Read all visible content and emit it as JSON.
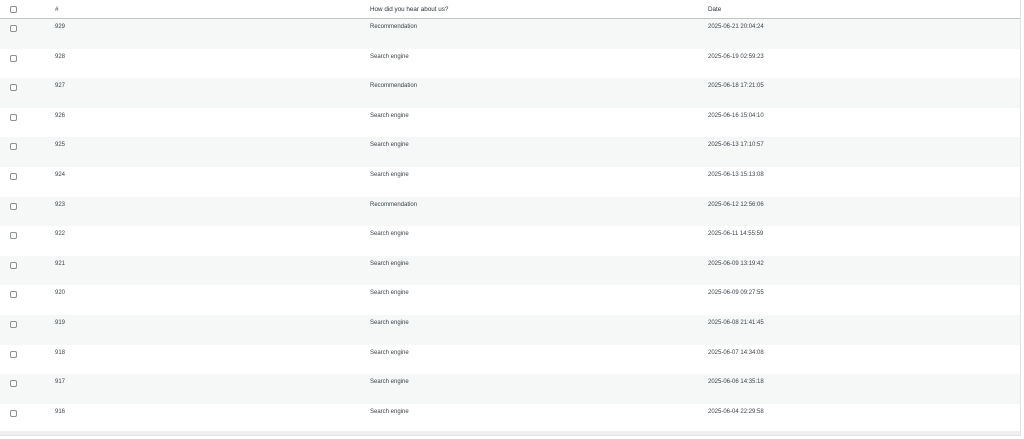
{
  "table": {
    "columns": {
      "id": "#",
      "source": "How did you hear about us?",
      "date": "Date"
    },
    "rows": [
      {
        "id": "929",
        "source": "Recommendation",
        "date": "2025-06-21 20:04:24"
      },
      {
        "id": "928",
        "source": "Search engine",
        "date": "2025-06-19 02:59:23"
      },
      {
        "id": "927",
        "source": "Recommendation",
        "date": "2025-06-18 17:21:05"
      },
      {
        "id": "926",
        "source": "Search engine",
        "date": "2025-06-16 15:04:10"
      },
      {
        "id": "925",
        "source": "Search engine",
        "date": "2025-06-13 17:10:57"
      },
      {
        "id": "924",
        "source": "Search engine",
        "date": "2025-06-13 15:13:08"
      },
      {
        "id": "923",
        "source": "Recommendation",
        "date": "2025-06-12 12:56:06"
      },
      {
        "id": "922",
        "source": "Search engine",
        "date": "2025-06-11 14:55:59"
      },
      {
        "id": "921",
        "source": "Search engine",
        "date": "2025-06-09 13:19:42"
      },
      {
        "id": "920",
        "source": "Search engine",
        "date": "2025-06-09 09:27:55"
      },
      {
        "id": "919",
        "source": "Search engine",
        "date": "2025-06-08 21:41:45"
      },
      {
        "id": "918",
        "source": "Search engine",
        "date": "2025-06-07 14:34:08"
      },
      {
        "id": "917",
        "source": "Search engine",
        "date": "2025-06-06 14:35:18"
      },
      {
        "id": "916",
        "source": "Search engine",
        "date": "2025-06-04 22:29:58"
      }
    ]
  },
  "colors": {
    "stripe": "#f6f7f7",
    "text": "#3c434a",
    "border": "#c3c4c7"
  }
}
